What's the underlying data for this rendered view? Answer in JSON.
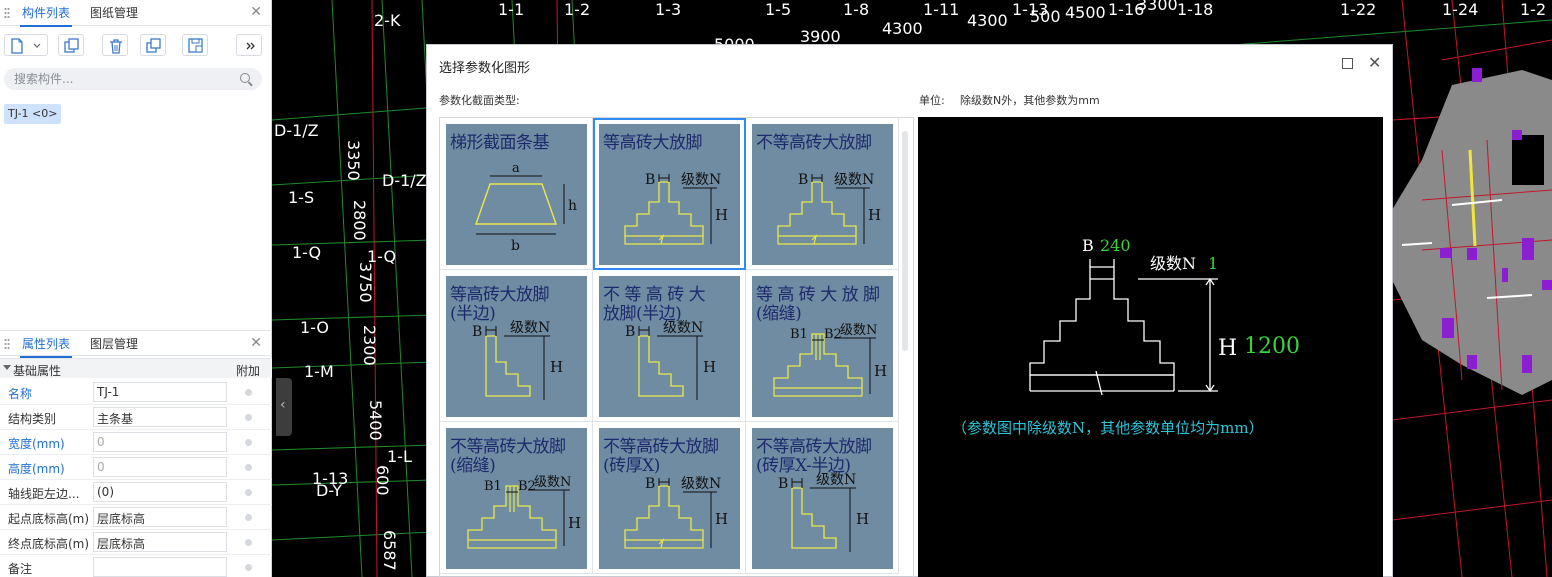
{
  "left_panel": {
    "top_tabs": [
      "构件列表",
      "图纸管理"
    ],
    "search_placeholder": "搜索构件...",
    "component_item": "TJ-1 <0>",
    "bottom_tabs": [
      "属性列表",
      "图层管理"
    ],
    "prop_group": "基础属性",
    "prop_extra_header": "附加",
    "properties": [
      {
        "label": "名称",
        "value": "TJ-1",
        "blue": true
      },
      {
        "label": "结构类别",
        "value": "主条基",
        "blue": false
      },
      {
        "label": "宽度(mm)",
        "value": "0",
        "blue": true
      },
      {
        "label": "高度(mm)",
        "value": "0",
        "blue": true
      },
      {
        "label": "轴线距左边...",
        "value": "(0)",
        "blue": false
      },
      {
        "label": "起点底标高(m)",
        "value": "层底标高",
        "blue": false
      },
      {
        "label": "终点底标高(m)",
        "value": "层底标高",
        "blue": false
      },
      {
        "label": "备注",
        "value": "",
        "blue": false
      }
    ]
  },
  "cad_labels": {
    "top": [
      "1-1",
      "1-2",
      "1-3",
      "1-5",
      "1-8",
      "1-11",
      "1-13",
      "1-16",
      "1-18",
      "1-22",
      "1-24",
      "1-2"
    ],
    "dims_top": [
      "5000",
      "3900",
      "4300",
      "4300",
      "500",
      "4500",
      "3300"
    ],
    "axis_left": [
      "2-K",
      "D-1/Z",
      "1-S",
      "D-1/Z",
      "1-Q",
      "1-Q",
      "1-O",
      "1-M",
      "1-L",
      "1-13",
      "D-Y"
    ],
    "dims_vertical": [
      "3350",
      "2800",
      "3750",
      "2300",
      "5400",
      "600",
      "6587"
    ]
  },
  "dialog": {
    "title": "选择参数化图形",
    "type_label": "参数化截面类型:",
    "unit_label": "单位:",
    "unit_text": "除级数N外，其他参数为mm",
    "tiles": [
      {
        "title": "梯形截面条基",
        "kind": "trapezoid",
        "selected": false
      },
      {
        "title": "等高砖大放脚",
        "kind": "step_sym",
        "selected": true
      },
      {
        "title": "不等高砖大放脚",
        "kind": "step_sym",
        "selected": false
      },
      {
        "title": "等高砖大放脚\n(半边)",
        "kind": "step_half",
        "selected": false
      },
      {
        "title": "不 等 高 砖 大\n放脚(半边)",
        "kind": "step_half",
        "selected": false
      },
      {
        "title": "等 高 砖 大 放 脚\n(缩缝)",
        "kind": "step_gap",
        "selected": false
      },
      {
        "title": "不等高砖大放脚\n(缩缝)",
        "kind": "step_gap",
        "selected": false
      },
      {
        "title": "不等高砖大放脚\n(砖厚X)",
        "kind": "step_sym",
        "selected": false
      },
      {
        "title": "不等高砖大放脚\n(砖厚X-半边)",
        "kind": "step_half",
        "selected": false
      }
    ],
    "tile_labels": {
      "a": "a",
      "b": "b",
      "h": "h",
      "B": "B",
      "B1": "B1",
      "B2": "B2",
      "N": "级数N",
      "H": "H"
    },
    "preview": {
      "B_label": "B",
      "B_value": "240",
      "N_label": "级数N",
      "N_value": "1",
      "H_label": "H",
      "H_value": "1200",
      "note": "（参数图中除级数N，其他参数单位均为mm）",
      "colors": {
        "value": "#35d63a",
        "note": "#29c6d9",
        "line": "#ffffff"
      }
    }
  }
}
